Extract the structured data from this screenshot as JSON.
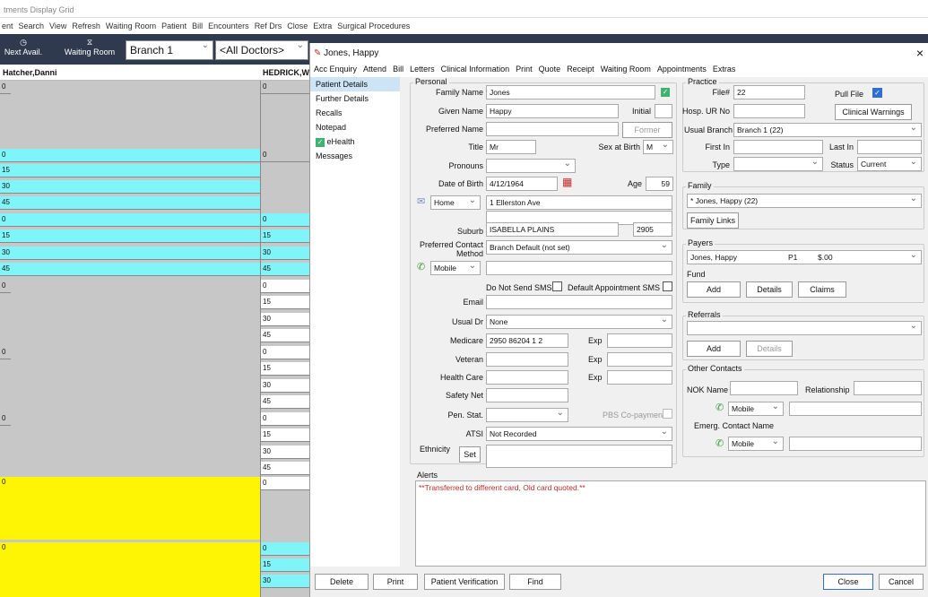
{
  "bg": {
    "title": "tments Display Grid",
    "menu": [
      "ent",
      "Search",
      "View",
      "Refresh",
      "Waiting Room",
      "Patient",
      "Bill",
      "Encounters",
      "Ref Drs",
      "Close",
      "Extra",
      "Surgical Procedures"
    ],
    "next_avail": "Next Avail.",
    "waiting_room": "Waiting Room",
    "branch": "Branch 1",
    "doctors": "<All Doctors>",
    "col1": "Hatcher,Danni",
    "col2": "HEDRICK,WA",
    "zero": "0",
    "q15": "15",
    "q30": "30",
    "q45": "45"
  },
  "dialog": {
    "title": "Jones, Happy",
    "close_x": "×",
    "menu": [
      "Acc Enquiry",
      "Attend",
      "Bill",
      "Letters",
      "Clinical Information",
      "Print",
      "Quote",
      "Receipt",
      "Waiting Room",
      "Appointments",
      "Extras"
    ],
    "nav": [
      "Patient Details",
      "Further Details",
      "Recalls",
      "Notepad",
      "eHealth",
      "Messages"
    ],
    "personal": {
      "group": "Personal",
      "family_name_label": "Family Name",
      "family_name": "Jones",
      "given_name_label": "Given Name",
      "given_name": "Happy",
      "initial_label": "Initial",
      "initial": "",
      "preferred_name_label": "Preferred Name",
      "former": "Former",
      "title_label": "Title",
      "title": "Mr",
      "sex_label": "Sex at Birth",
      "sex": "M",
      "pronouns_label": "Pronouns",
      "dob_label": "Date of Birth",
      "dob": "4/12/1964",
      "age_label": "Age",
      "age": "59",
      "addr_type": "Home",
      "address": "1 Ellerston Ave",
      "suburb_label": "Suburb",
      "suburb": "ISABELLA PLAINS",
      "postcode": "2905",
      "pcm_label": "Preferred Contact Method",
      "pcm": "Branch Default (not set)",
      "phone_type": "Mobile",
      "no_sms": "Do Not Send SMS",
      "default_sms": "Default Appointment SMS",
      "email_label": "Email",
      "usual_dr_label": "Usual Dr",
      "usual_dr": "None",
      "medicare_label": "Medicare",
      "medicare": "2950 86204 1  2",
      "exp": "Exp",
      "veteran_label": "Veteran",
      "health_care_label": "Health Care",
      "safety_net_label": "Safety Net",
      "pen_stat_label": "Pen. Stat.",
      "pbs": "PBS Co-payment",
      "atsi_label": "ATSI",
      "atsi": "Not Recorded",
      "ethnicity_label": "Ethnicity",
      "set": "Set"
    },
    "practice": {
      "group": "Practice",
      "file_label": "File#",
      "file": "22",
      "pull_file": "Pull File",
      "hosp_label": "Hosp. UR No",
      "clinical_warnings": "Clinical Warnings",
      "usual_branch_label": "Usual Branch",
      "usual_branch": "Branch 1  (22)",
      "first_in": "First In",
      "last_in": "Last In",
      "type_label": "Type",
      "status_label": "Status",
      "status": "Current"
    },
    "family": {
      "group": "Family",
      "value": "* Jones, Happy (22)",
      "links": "Family Links"
    },
    "payers": {
      "group": "Payers",
      "name": "Jones, Happy",
      "p": "P1",
      "amt": "$.00",
      "fund": "Fund",
      "add": "Add",
      "details": "Details",
      "claims": "Claims"
    },
    "referrals": {
      "group": "Referrals",
      "add": "Add",
      "details": "Details"
    },
    "contacts": {
      "group": "Other Contacts",
      "nok": "NOK Name",
      "relationship": "Relationship",
      "mobile": "Mobile",
      "emerg": "Emerg. Contact Name"
    },
    "alerts": {
      "group": "Alerts",
      "text": "**Transferred to different card, Old card quoted.**"
    },
    "buttons": {
      "delete": "Delete",
      "print": "Print",
      "verify": "Patient Verification",
      "find": "Find",
      "close": "Close",
      "cancel": "Cancel"
    }
  }
}
